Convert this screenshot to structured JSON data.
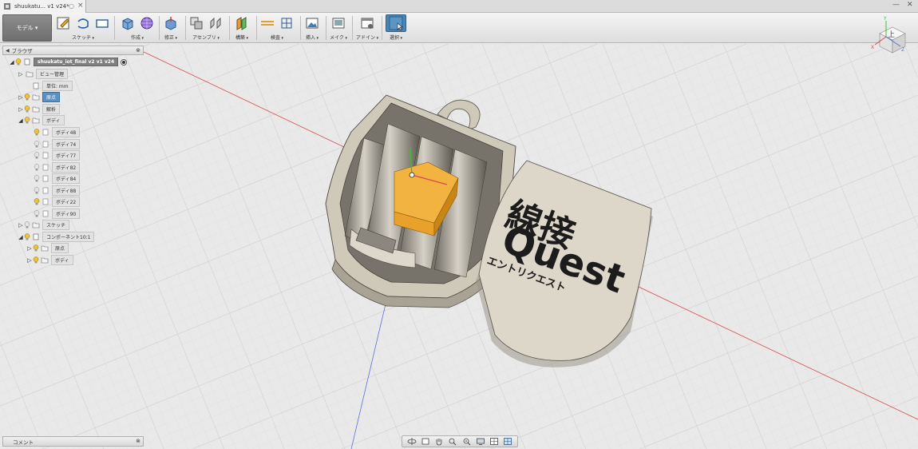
{
  "window": {
    "tab_title": "shuukatu... v1 v24*",
    "tab_dot": "○",
    "tab_close": "×",
    "minimize": "—",
    "close": "✕"
  },
  "toolbar": {
    "workspace": "モデル ▾",
    "groups": [
      {
        "id": "sketch",
        "label": "スケッチ"
      },
      {
        "id": "create",
        "label": "作成"
      },
      {
        "id": "modify",
        "label": "修正"
      },
      {
        "id": "assemble",
        "label": "アセンブリ"
      },
      {
        "id": "construct",
        "label": "構築"
      },
      {
        "id": "inspect",
        "label": "検査"
      },
      {
        "id": "insert",
        "label": "挿入"
      },
      {
        "id": "make",
        "label": "メイク"
      },
      {
        "id": "addins",
        "label": "アドイン"
      },
      {
        "id": "select",
        "label": "選択"
      }
    ]
  },
  "browser": {
    "title": "ブラウザ",
    "pin": "⊗",
    "root": "shuukatu_iot_final v2 v1 v24",
    "items": {
      "view_mgmt": "ビュー管理",
      "units": "単位: mm",
      "origin": "原点",
      "analysis": "解析",
      "bodies": "ボディ",
      "body48": "ボディ48",
      "body74": "ボディ74",
      "body77": "ボディ77",
      "body82": "ボディ82",
      "body84": "ボディ84",
      "body88": "ボディ88",
      "body22": "ボディ22",
      "body90": "ボディ90",
      "sketch": "スケッチ",
      "component": "コンポーネント10:1",
      "comp_origin": "原点",
      "comp_bodies": "ボディ"
    }
  },
  "viewcube": {
    "face": "上",
    "axis_x": "X",
    "axis_y": "Y",
    "axis_z": "Z"
  },
  "model": {
    "plate_title": "線接",
    "plate_logo": "Quest",
    "plate_kana": "エントリクエスト"
  },
  "comments": {
    "title": "コメント",
    "pin": "⊗"
  },
  "colors": {
    "accent_blue": "#4a86b5",
    "selection_orange": "#f0a020",
    "model_tan": "#d9d3c4",
    "grid": "#d0d0d0",
    "axis_red": "#d84a4a",
    "axis_blue": "#5a6fd8"
  }
}
